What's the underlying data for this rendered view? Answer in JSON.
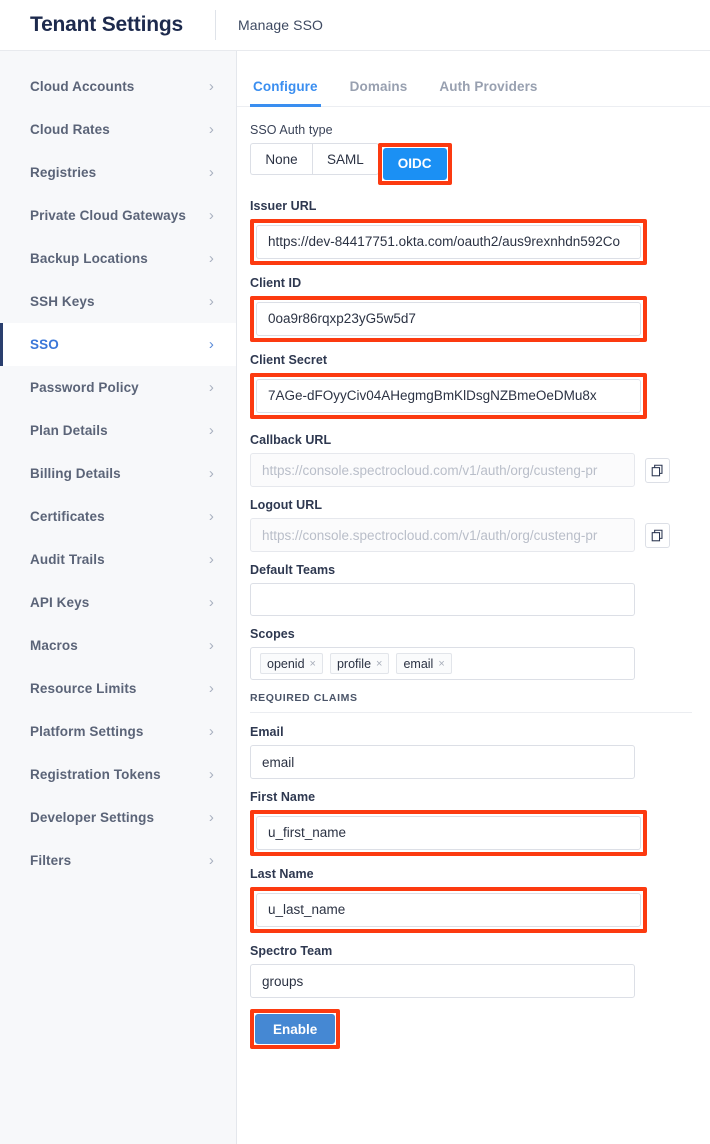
{
  "topbar": {
    "title": "Tenant Settings",
    "subtitle": "Manage SSO"
  },
  "sidebar": {
    "items": [
      {
        "label": "Cloud Accounts",
        "active": false
      },
      {
        "label": "Cloud Rates",
        "active": false
      },
      {
        "label": "Registries",
        "active": false
      },
      {
        "label": "Private Cloud Gateways",
        "active": false
      },
      {
        "label": "Backup Locations",
        "active": false
      },
      {
        "label": "SSH Keys",
        "active": false
      },
      {
        "label": "SSO",
        "active": true
      },
      {
        "label": "Password Policy",
        "active": false
      },
      {
        "label": "Plan Details",
        "active": false
      },
      {
        "label": "Billing Details",
        "active": false
      },
      {
        "label": "Certificates",
        "active": false
      },
      {
        "label": "Audit Trails",
        "active": false
      },
      {
        "label": "API Keys",
        "active": false
      },
      {
        "label": "Macros",
        "active": false
      },
      {
        "label": "Resource Limits",
        "active": false
      },
      {
        "label": "Platform Settings",
        "active": false
      },
      {
        "label": "Registration Tokens",
        "active": false
      },
      {
        "label": "Developer Settings",
        "active": false
      },
      {
        "label": "Filters",
        "active": false
      }
    ],
    "chevron": "›"
  },
  "tabs": [
    {
      "label": "Configure",
      "active": true
    },
    {
      "label": "Domains",
      "active": false
    },
    {
      "label": "Auth Providers",
      "active": false
    }
  ],
  "form": {
    "auth_type": {
      "label": "SSO Auth type",
      "options": [
        "None",
        "SAML",
        "OIDC"
      ],
      "selected": "OIDC"
    },
    "issuer_url": {
      "label": "Issuer URL",
      "value": "https://dev-84417751.okta.com/oauth2/aus9rexnhdn592Co"
    },
    "client_id": {
      "label": "Client ID",
      "value": "0oa9r86rqxp23yG5w5d7"
    },
    "client_secret": {
      "label": "Client Secret",
      "value": "7AGe-dFOyyCiv04AHegmgBmKlDsgNZBmeOeDMu8x"
    },
    "callback_url": {
      "label": "Callback URL",
      "placeholder": "https://console.spectrocloud.com/v1/auth/org/custeng-pr",
      "value": ""
    },
    "logout_url": {
      "label": "Logout URL",
      "placeholder": "https://console.spectrocloud.com/v1/auth/org/custeng-pr",
      "value": ""
    },
    "default_teams": {
      "label": "Default Teams",
      "value": ""
    },
    "scopes": {
      "label": "Scopes",
      "tags": [
        "openid",
        "profile",
        "email"
      ],
      "remove_glyph": "×"
    },
    "required_claims_header": "REQUIRED CLAIMS",
    "email_claim": {
      "label": "Email",
      "value": "email"
    },
    "first_name_claim": {
      "label": "First Name",
      "value": "u_first_name"
    },
    "last_name_claim": {
      "label": "Last Name",
      "value": "u_last_name"
    },
    "spectro_team_claim": {
      "label": "Spectro Team",
      "value": "groups"
    },
    "submit": {
      "label": "Enable"
    }
  },
  "colors": {
    "accent_blue": "#3a8ef0",
    "oidc_blue": "#1b90f4",
    "enable_blue": "#4588d3",
    "annotation_red": "#fc3a10",
    "sidebar_bg": "#f7f8fa",
    "title_navy": "#1d2a4d"
  }
}
